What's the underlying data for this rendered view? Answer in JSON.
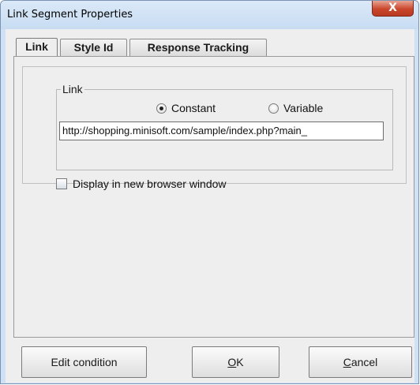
{
  "window": {
    "title": "Link Segment Properties",
    "close_glyph": "X"
  },
  "tabs": [
    {
      "label": "Link",
      "active": true
    },
    {
      "label": "Style Id",
      "active": false
    },
    {
      "label": "Response Tracking",
      "active": false
    }
  ],
  "link_group": {
    "legend": "Link",
    "radio_options": [
      {
        "label": "Constant",
        "selected": true
      },
      {
        "label": "Variable",
        "selected": false
      }
    ],
    "url_value": "http://shopping.minisoft.com/sample/index.php?main_"
  },
  "new_window_checkbox": {
    "label": "Display in new browser window",
    "checked": false
  },
  "buttons": {
    "edit_condition": "Edit condition",
    "ok_mnemonic": "O",
    "ok_rest": "K",
    "cancel_mnemonic": "C",
    "cancel_rest": "ancel"
  }
}
